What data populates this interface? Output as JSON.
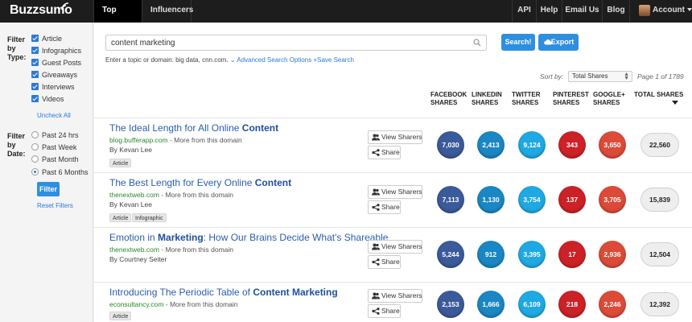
{
  "nav": {
    "logo": "Buzzsumo",
    "tabs": [
      "Top Content",
      "Influencers"
    ],
    "right": [
      "API",
      "Help",
      "Email Us",
      "Blog",
      "Account"
    ]
  },
  "sidebar": {
    "type_label": [
      "Filter",
      "by",
      "Type:"
    ],
    "types": [
      "Article",
      "Infographics",
      "Guest Posts",
      "Giveaways",
      "Interviews",
      "Videos"
    ],
    "uncheck_all": "Uncheck All",
    "date_label": [
      "Filter",
      "by",
      "Date:"
    ],
    "dates": [
      "Past 24 hrs",
      "Past Week",
      "Past Month",
      "Past 6 Months"
    ],
    "selected_date": "Past 6 Months",
    "filter_button": "Filter",
    "reset": "Reset Filters"
  },
  "search": {
    "value": "content marketing",
    "search_button": "Search!",
    "export_button": "Export",
    "hint": "Enter a topic or domain: big data, cnn.com.",
    "advanced": "Advanced Search Options",
    "save": "Save Search"
  },
  "sort": {
    "label": "Sort by:",
    "value": "Total Shares",
    "page_info": "Page 1 of 1789"
  },
  "columns": [
    [
      "FACEBOOK",
      "SHARES"
    ],
    [
      "LINKEDIN",
      "SHARES"
    ],
    [
      "TWITTER",
      "SHARES"
    ],
    [
      "PINTEREST",
      "SHARES"
    ],
    [
      "GOOGLE+",
      "SHARES"
    ],
    [
      "TOTAL SHARES"
    ]
  ],
  "buttons": {
    "view_sharers": "View Sharers",
    "share": "Share"
  },
  "more_from_domain": " - More from this domain",
  "by_prefix": "By ",
  "colors": {
    "facebook": "#3b5a9a",
    "linkedin": "#1a86c3",
    "twitter": "#1fa8e1",
    "pinterest": "#cc2127",
    "google": "#dc4a38"
  },
  "results": [
    {
      "title_plain": "The Ideal Length for All Online ",
      "title_bold": "Content",
      "domain": "blog.bufferapp.com",
      "author": "Kevan Lee",
      "tags": [
        "Article"
      ],
      "facebook": "7,030",
      "linkedin": "2,413",
      "twitter": "9,124",
      "pinterest": "343",
      "google": "3,650",
      "total": "22,560"
    },
    {
      "title_plain": "The Best Length for Every Online ",
      "title_bold": "Content",
      "domain": "thenextweb.com",
      "author": "Kevan Lee",
      "tags": [
        "Article",
        "Infographic"
      ],
      "facebook": "7,113",
      "linkedin": "1,130",
      "twitter": "3,754",
      "pinterest": "137",
      "google": "3,705",
      "total": "15,839"
    },
    {
      "title_pre": "Emotion in ",
      "title_bold_mid": "Marketing",
      "title_post": ": How Our Brains Decide What's Shareable",
      "domain": "thenextweb.com",
      "author": "Courtney Seiter",
      "tags": [
        "Article"
      ],
      "facebook": "5,244",
      "linkedin": "912",
      "twitter": "3,395",
      "pinterest": "17",
      "google": "2,936",
      "total": "12,504"
    },
    {
      "title_plain": "Introducing The Periodic Table of ",
      "title_bold": "Content Marketing",
      "domain": "econsultancy.com",
      "author": "",
      "tags": [
        "Article"
      ],
      "facebook": "2,153",
      "linkedin": "1,666",
      "twitter": "6,109",
      "pinterest": "218",
      "google": "2,246",
      "total": "12,392"
    }
  ]
}
